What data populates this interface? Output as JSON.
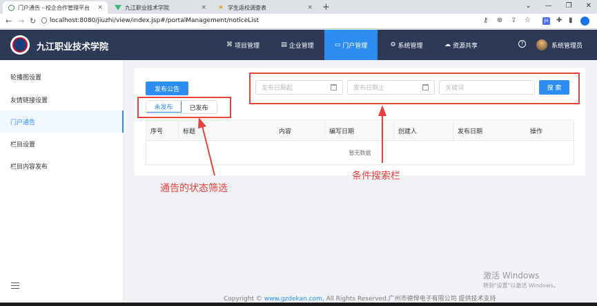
{
  "browser": {
    "tabs": [
      {
        "title": "门户通告 - 校企合作管理平台",
        "active": true
      },
      {
        "title": "九江职业技术学院",
        "active": false
      },
      {
        "title": "学生返校调查表",
        "active": false
      }
    ],
    "close_glyph": "×",
    "new_tab_glyph": "+",
    "url": "localhost:8080/jiuzhi/view/index.jsp#/portalManagement/noticeList",
    "ext_badge": "JH"
  },
  "header": {
    "site_title": "九江职业技术学院",
    "menu": [
      {
        "label": "项目管理",
        "icon": "⌘"
      },
      {
        "label": "企业管理",
        "icon": "▤"
      },
      {
        "label": "门户管理",
        "icon": "▭",
        "active": true
      },
      {
        "label": "系统管理",
        "icon": "⚙"
      },
      {
        "label": "资源共享",
        "icon": "☁"
      }
    ],
    "help_glyph": "?",
    "username": "系统管理员"
  },
  "sidebar": {
    "items": [
      {
        "label": "轮播图设置"
      },
      {
        "label": "友情链接设置"
      },
      {
        "label": "门户通告",
        "active": true
      },
      {
        "label": "栏目设置"
      },
      {
        "label": "栏目内容发布"
      }
    ]
  },
  "main": {
    "publish_button": "发布公告",
    "status_filter": {
      "options": [
        "未发布",
        "已发布"
      ],
      "selected": "未发布"
    },
    "search": {
      "start_date_placeholder": "发布日期起",
      "end_date_placeholder": "发布日期止",
      "keyword_placeholder": "关键词",
      "button": "搜 索"
    },
    "table": {
      "columns": [
        "序号",
        "标题",
        "内容",
        "编写日期",
        "创建人",
        "发布日期",
        "操作"
      ],
      "empty_text": "暂无数据"
    }
  },
  "annotations": {
    "status_filter_note": "通告的状态筛选",
    "search_bar_note": "条件搜索栏"
  },
  "footer": {
    "prefix": "Copyright ©",
    "link": "www.gzdekan.com",
    "suffix": ", All Rights Reserved.广州市德悍电子有限公司 提供技术支持"
  },
  "watermark": {
    "line1": "激活 Windows",
    "line2": "转到\"设置\"以激活 Windows。"
  },
  "colors": {
    "accent": "#2d8cf0",
    "header_bg": "#2e3955",
    "annotation": "#e8413b"
  }
}
